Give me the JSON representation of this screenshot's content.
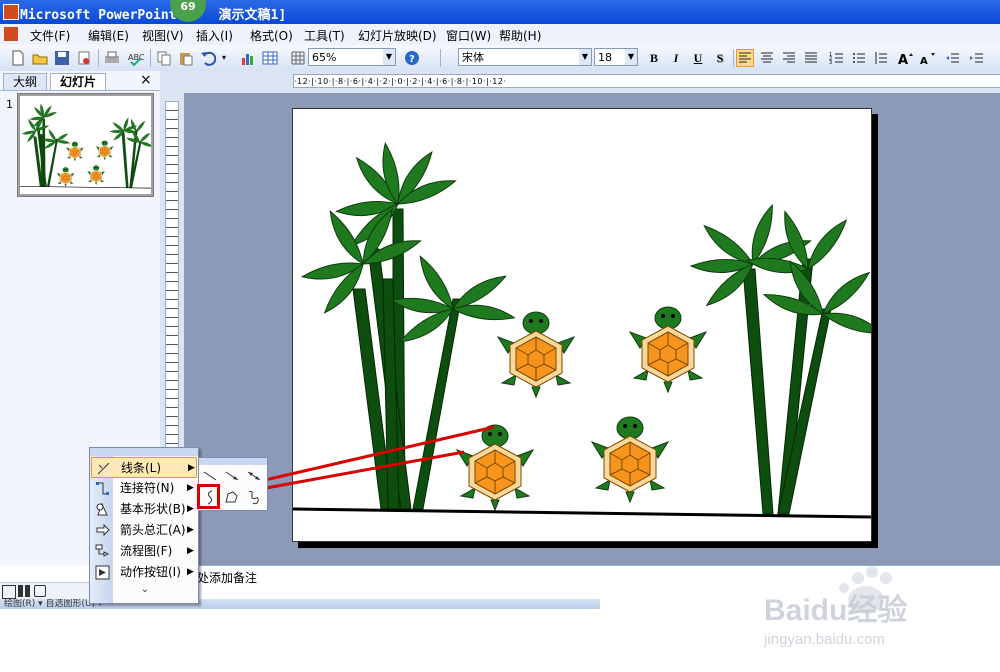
{
  "window": {
    "app_title": "Microsoft PowerPoint",
    "doc_title": "演示文稿1]",
    "badge": "69"
  },
  "menubar": [
    "文件(F)",
    "编辑(E)",
    "视图(V)",
    "插入(I)",
    "格式(O)",
    "工具(T)",
    "幻灯片放映(D)",
    "窗口(W)",
    "帮助(H)"
  ],
  "toolbar": {
    "zoom": "65%",
    "font": "宋体",
    "size": "18",
    "bold": "B",
    "italic": "I",
    "underline": "U",
    "shadow": "S"
  },
  "left_panel": {
    "tabs": [
      "大纲",
      "幻灯片"
    ],
    "close": "×",
    "slide_number": "1"
  },
  "ruler": {
    "horizontal": "·12·|·10·|·8·|·6·|·4·|·2·|·0·|·2·|·4·|·6·|·8·|·10·|·12·"
  },
  "notes": {
    "placeholder": "处添加备注"
  },
  "drawing_toolbar": {
    "label": "绘图(R) ▾  自选图形(U) ▾"
  },
  "autoshapes_menu": {
    "items": [
      {
        "label": "线条(L)",
        "icon": "lines-icon"
      },
      {
        "label": "连接符(N)",
        "icon": "connectors-icon"
      },
      {
        "label": "基本形状(B)",
        "icon": "basic-shapes-icon"
      },
      {
        "label": "箭头总汇(A)",
        "icon": "block-arrows-icon"
      },
      {
        "label": "流程图(F)",
        "icon": "flowchart-icon"
      },
      {
        "label": "动作按钮(I)",
        "icon": "action-buttons-icon"
      }
    ],
    "more": "⌄"
  },
  "lines_submenu": {
    "items": [
      "line-icon",
      "arrow-icon",
      "double-arrow-icon",
      "curve-icon",
      "freeform-icon",
      "scribble-icon"
    ]
  },
  "colors": {
    "titlebar": "#0a49d6",
    "highlight": "#d80000",
    "leaf": "#1f7a1f",
    "trunk": "#0d4d0d",
    "shell": "#f7941d"
  },
  "watermark": {
    "brand": "Baidu经验",
    "url": "jingyan.baidu.com"
  }
}
